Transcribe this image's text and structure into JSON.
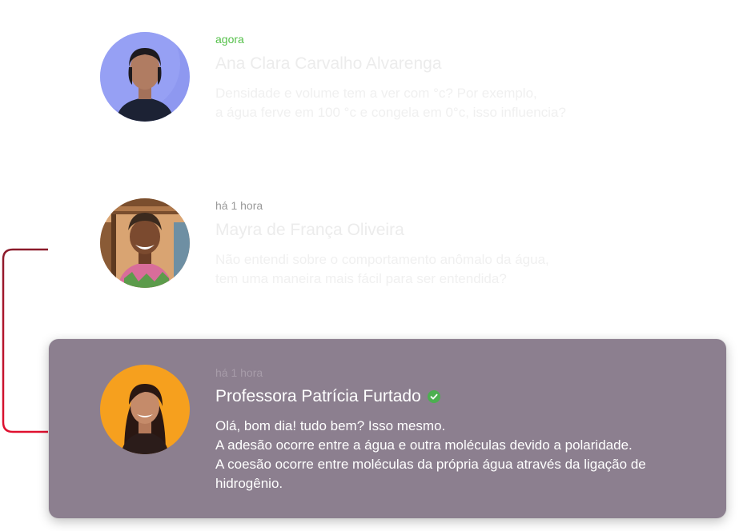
{
  "comments": [
    {
      "time": "agora",
      "author": "Ana Clara Carvalho Alvarenga",
      "lines": [
        "Densidade e volume tem a ver com °c? Por exemplo,",
        "a água ferve em 100 °c e congela em 0°c, isso influencia?"
      ]
    },
    {
      "time": "há 1 hora",
      "author": "Mayra de França Oliveira",
      "lines": [
        "Não entendi sobre o comportamento anômalo da água,",
        "tem uma maneira mais fácil para ser entendida?"
      ]
    },
    {
      "time": "há 1 hora",
      "author": "Professora Patrícia Furtado",
      "verified": true,
      "lines": [
        "Olá, bom dia! tudo bem? Isso mesmo.",
        "A adesão ocorre entre a água e outra moléculas devido a polaridade.",
        "A coesão ocorre entre moléculas da própria água através da ligação de",
        "hidrogênio."
      ]
    }
  ],
  "icons": {
    "verified": "check-circle-icon"
  },
  "colors": {
    "time_recent": "#55c04a",
    "card_background": "#8c7f8f",
    "connector_top": "#8b1a2b",
    "connector_bottom": "#e0102f",
    "verified_badge": "#4caf50"
  }
}
